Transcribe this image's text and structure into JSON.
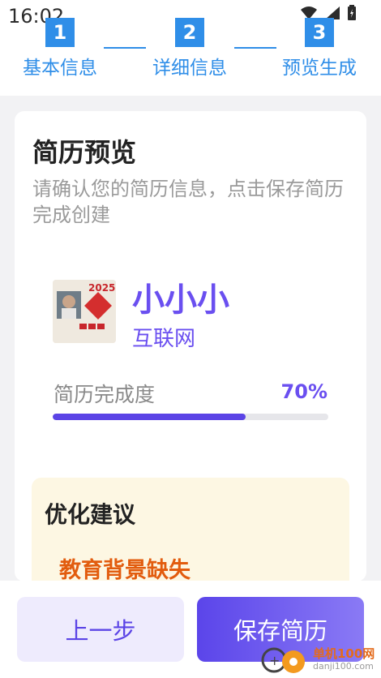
{
  "status_bar": {
    "time": "16:02"
  },
  "steps": [
    {
      "num": "1",
      "label": "基本信息"
    },
    {
      "num": "2",
      "label": "详细信息"
    },
    {
      "num": "3",
      "label": "预览生成"
    }
  ],
  "card": {
    "title": "简历预览",
    "subtitle": "请确认您的简历信息，点击保存简历完成创建",
    "profile": {
      "name": "小小小",
      "field": "互联网",
      "avatar_text": "2025"
    },
    "progress": {
      "label": "简历完成度",
      "value_text": "70%",
      "value": 0.7
    },
    "suggestions": {
      "title": "优化建议",
      "items": [
        "教育背景缺失"
      ]
    }
  },
  "buttons": {
    "prev": "上一步",
    "save": "保存简历"
  },
  "watermark": {
    "site_name": "单机100网",
    "url": "danji100.com"
  },
  "colors": {
    "step_blue": "#2f8ee8",
    "accent_purple": "#6a4ff0",
    "warning_orange": "#e25c0e"
  }
}
